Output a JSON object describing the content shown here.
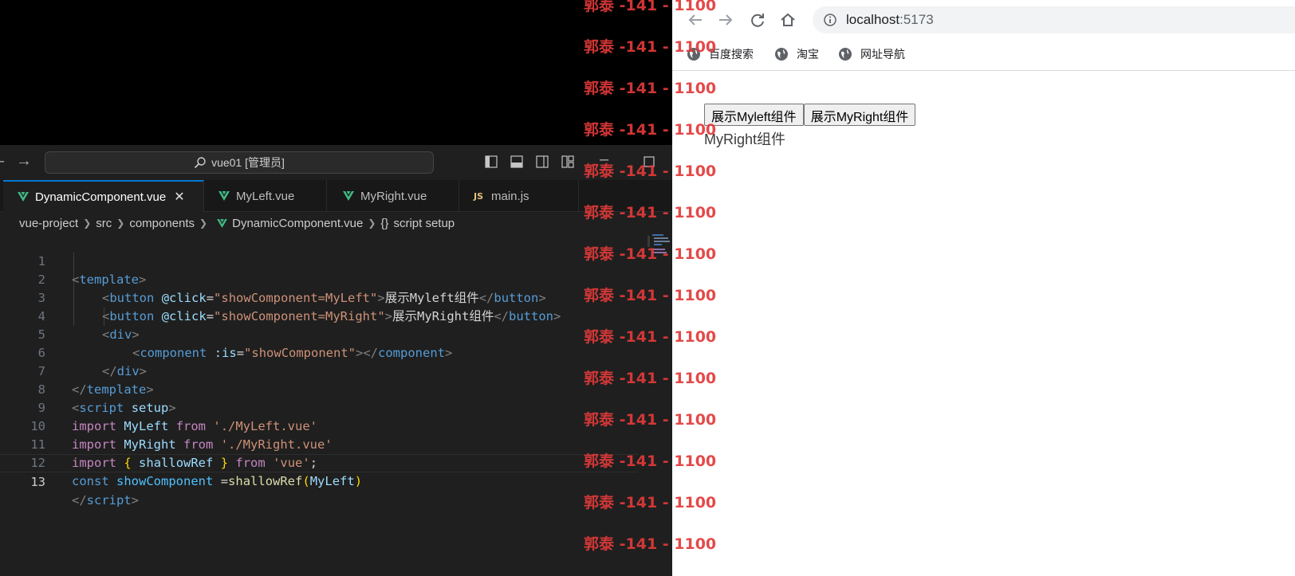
{
  "vscode": {
    "search_label": "vue01 [管理员]",
    "tabs": [
      {
        "label": "DynamicComponent.vue",
        "icon": "vue-icon",
        "active": true
      },
      {
        "label": "MyLeft.vue",
        "icon": "vue-icon",
        "active": false
      },
      {
        "label": "MyRight.vue",
        "icon": "vue-icon",
        "active": false
      },
      {
        "label": "main.js",
        "icon": "js-icon",
        "active": false
      }
    ],
    "close_glyph": "✕",
    "js_badge": "JS",
    "breadcrumb": [
      "vue-project",
      "src",
      "components",
      "DynamicComponent.vue",
      "script setup"
    ],
    "breadcrumb_braces": "{}",
    "line_numbers": [
      "1",
      "2",
      "3",
      "4",
      "5",
      "6",
      "7",
      "8",
      "9",
      "10",
      "11",
      "12",
      "13"
    ],
    "code": {
      "l1": [
        "<",
        "template",
        ">"
      ],
      "l2": [
        "<",
        "button",
        "@click",
        "=",
        "\"showComponent=MyLeft\"",
        ">",
        "展示Myleft组件",
        "</",
        "button",
        ">"
      ],
      "l3": [
        "<",
        "button",
        "@click",
        "=",
        "\"showComponent=MyRight\"",
        ">",
        "展示MyRight组件",
        "</",
        "button",
        ">"
      ],
      "l4": [
        "<",
        "div",
        ">"
      ],
      "l5": [
        "<",
        "component",
        ":is",
        "=",
        "\"showComponent\"",
        "></",
        "component",
        ">"
      ],
      "l6": [
        "</",
        "div",
        ">"
      ],
      "l7": [
        "</",
        "template",
        ">"
      ],
      "l8": [
        "<",
        "script",
        "setup",
        ">"
      ],
      "l9": [
        "import",
        "MyLeft",
        "from",
        "'./MyLeft.vue'"
      ],
      "l10": [
        "import",
        "MyRight",
        "from",
        "'./MyRight.vue'"
      ],
      "l11": [
        "import",
        "{",
        "shallowRef",
        "}",
        "from",
        "'vue'",
        ";"
      ],
      "l12": [
        "const",
        "showComponent",
        "=",
        "shallowRef",
        "(",
        "MyLeft",
        ")"
      ],
      "l13": [
        "</",
        "script",
        ">"
      ]
    }
  },
  "browser": {
    "url_host": "localhost",
    "url_port": ":5173",
    "bookmarks": [
      "百度搜索",
      "淘宝",
      "网址导航"
    ],
    "buttons": [
      "展示Myleft组件",
      "展示MyRight组件"
    ],
    "component_text": "MyRight组件"
  },
  "watermark": {
    "text": "郭泰 -141 - 1100",
    "count": 14
  },
  "colors": {
    "editor_bg": "#1f1f1f",
    "accent": "#0078d4",
    "watermark": "#e23a3a"
  }
}
